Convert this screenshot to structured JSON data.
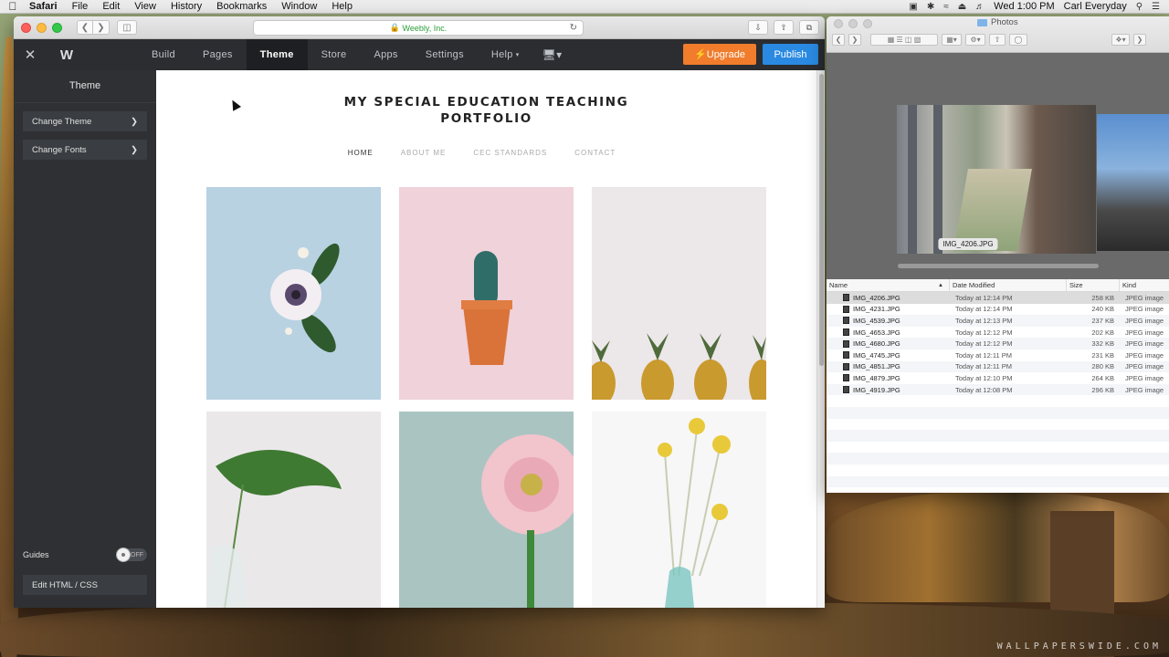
{
  "menubar": {
    "app": "Safari",
    "items": [
      "File",
      "Edit",
      "View",
      "History",
      "Bookmarks",
      "Window",
      "Help"
    ],
    "clock": "Wed 1:00 PM",
    "user": "Carl Everyday"
  },
  "safari": {
    "address": "Weebly, Inc."
  },
  "weebly": {
    "tabs": [
      "Build",
      "Pages",
      "Theme",
      "Store",
      "Apps",
      "Settings",
      "Help"
    ],
    "active_tab": "Theme",
    "upgrade_label": "Upgrade",
    "publish_label": "Publish",
    "sidebar": {
      "title": "Theme",
      "items": [
        "Change Theme",
        "Change Fonts"
      ],
      "guides_label": "Guides",
      "guides_state": "OFF",
      "edit_html_label": "Edit HTML / CSS"
    }
  },
  "site": {
    "title": "MY SPECIAL EDUCATION TEACHING PORTFOLIO",
    "nav": [
      "HOME",
      "ABOUT ME",
      "CEC STANDARDS",
      "CONTACT"
    ],
    "active_nav": "HOME"
  },
  "finder": {
    "title": "Photos",
    "coverflow_label": "IMG_4206.JPG",
    "columns": [
      "Name",
      "Date Modified",
      "Size",
      "Kind"
    ],
    "rows": [
      {
        "name": "IMG_4206.JPG",
        "date": "Today at 12:14 PM",
        "size": "258 KB",
        "kind": "JPEG image"
      },
      {
        "name": "IMG_4231.JPG",
        "date": "Today at 12:14 PM",
        "size": "240 KB",
        "kind": "JPEG image"
      },
      {
        "name": "IMG_4539.JPG",
        "date": "Today at 12:13 PM",
        "size": "237 KB",
        "kind": "JPEG image"
      },
      {
        "name": "IMG_4653.JPG",
        "date": "Today at 12:12 PM",
        "size": "202 KB",
        "kind": "JPEG image"
      },
      {
        "name": "IMG_4680.JPG",
        "date": "Today at 12:12 PM",
        "size": "332 KB",
        "kind": "JPEG image"
      },
      {
        "name": "IMG_4745.JPG",
        "date": "Today at 12:11 PM",
        "size": "231 KB",
        "kind": "JPEG image"
      },
      {
        "name": "IMG_4851.JPG",
        "date": "Today at 12:11 PM",
        "size": "280 KB",
        "kind": "JPEG image"
      },
      {
        "name": "IMG_4879.JPG",
        "date": "Today at 12:10 PM",
        "size": "264 KB",
        "kind": "JPEG image"
      },
      {
        "name": "IMG_4919.JPG",
        "date": "Today at 12:08 PM",
        "size": "296 KB",
        "kind": "JPEG image"
      }
    ]
  },
  "wallpaper_watermark": "WALLPAPERSWIDE.COM"
}
